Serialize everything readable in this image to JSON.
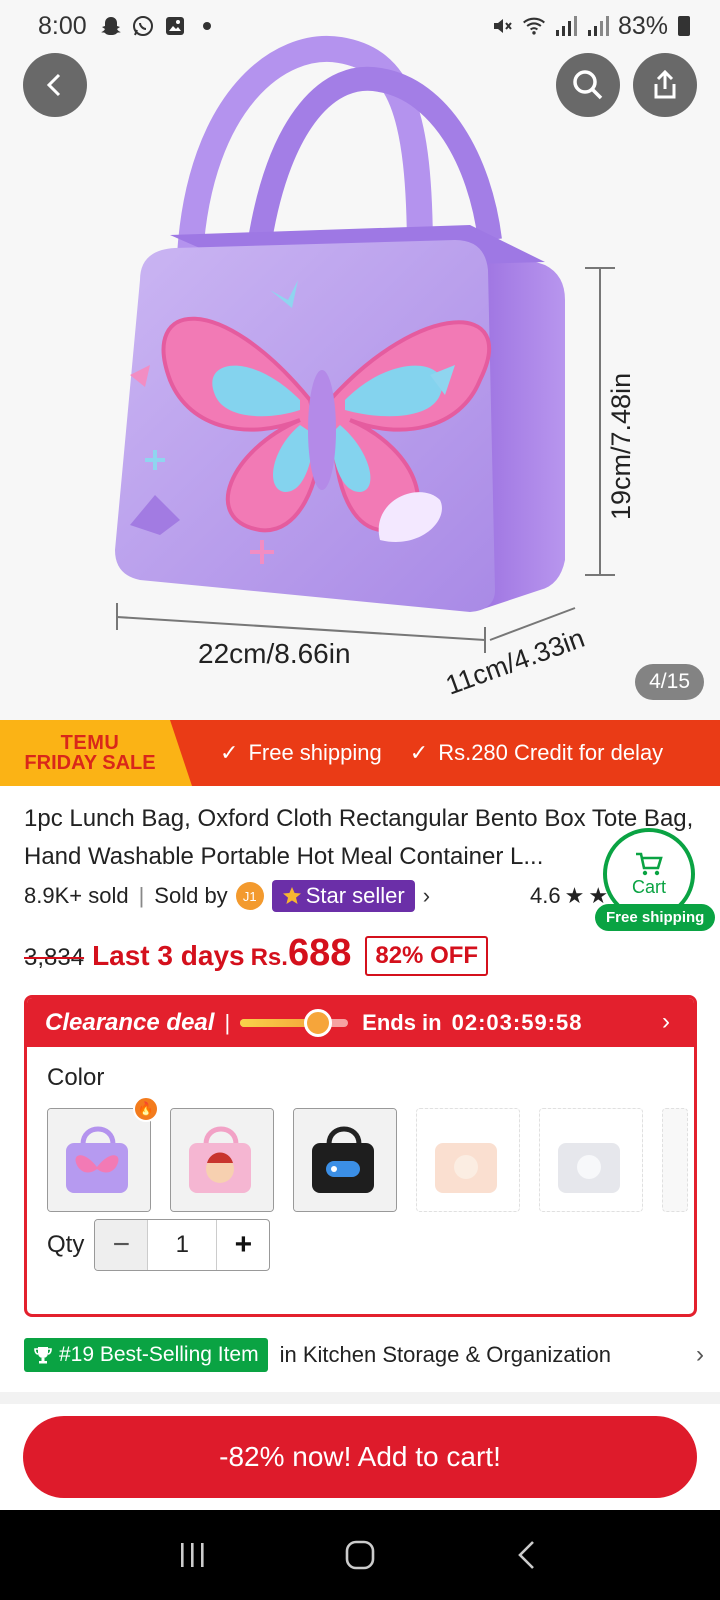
{
  "status_bar": {
    "time": "8:00",
    "battery": "83%",
    "icons": [
      "snapchat-icon",
      "whatsapp-icon",
      "gallery-icon",
      "dot-icon",
      "mute-icon",
      "wifi-icon",
      "signal-icon",
      "signal-icon",
      "battery-icon"
    ]
  },
  "gallery": {
    "counter": "4/15",
    "dim_height": "19cm/7.48in",
    "dim_width": "22cm/8.66in",
    "dim_depth": "11cm/4.33in"
  },
  "promo": {
    "badge_line1": "TEMU",
    "badge_line2": "FRIDAY SALE",
    "free_shipping": "Free shipping",
    "credit": "Rs.280 Credit for delay"
  },
  "product": {
    "title": "1pc Lunch Bag, Oxford Cloth Rectangular Bento Box Tote Bag, Hand Washable Portable Hot Meal Container L...",
    "sold": "8.9K+ sold",
    "sold_by": "Sold by",
    "seller_initials": "J1",
    "star_seller": "Star seller",
    "rating": "4.6",
    "original_price": "3,834",
    "last_days": "Last 3 days",
    "currency": "Rs.",
    "price": "688",
    "discount": "82% OFF"
  },
  "cart_float": {
    "label": "Cart",
    "free_shipping": "Free shipping"
  },
  "clearance": {
    "title": "Clearance deal",
    "ends_in": "Ends in",
    "timer": "02:03:59:58",
    "progress": 0.72
  },
  "options": {
    "color_label": "Color",
    "qty_label": "Qty",
    "qty_value": "1"
  },
  "best_seller": {
    "badge": "#19 Best-Selling Item",
    "category": "in Kitchen Storage & Organization"
  },
  "cta": {
    "label": "-82% now! Add to cart!"
  },
  "colors": {
    "accent_red": "#de1b2b",
    "promo_orange": "#ea3b16",
    "green": "#0aa343",
    "star_purple": "#6b2fa8"
  }
}
